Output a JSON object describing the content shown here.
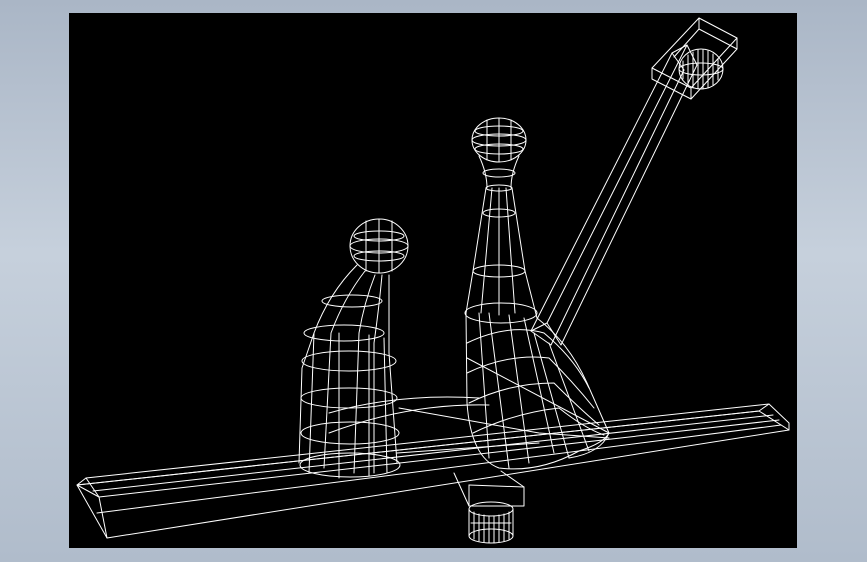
{
  "background": {
    "frame_color": "#b4c0ce",
    "viewport_color": "#000000"
  },
  "model": {
    "line_color": "#ffffff",
    "rendering": "wireframe"
  }
}
